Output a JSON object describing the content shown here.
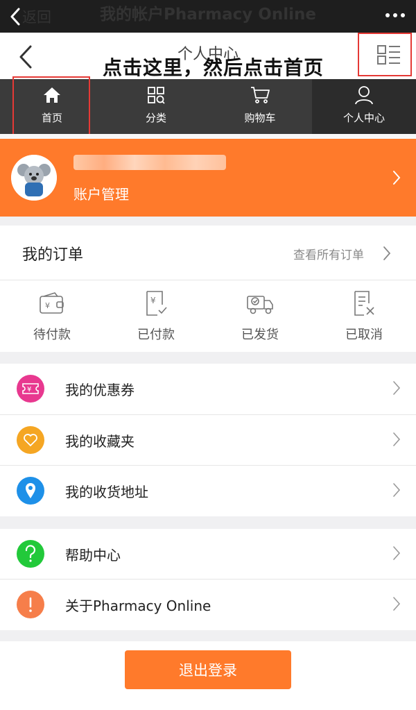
{
  "wechat_bar": {
    "back_label": "返回",
    "title": "我的帐户Pharmacy Online"
  },
  "header": {
    "title": "个人中心",
    "annotation": "点击这里，然后点击首页"
  },
  "nav": [
    {
      "label": "首页",
      "icon": "home-icon"
    },
    {
      "label": "分类",
      "icon": "category-icon"
    },
    {
      "label": "购物车",
      "icon": "cart-icon"
    },
    {
      "label": "个人中心",
      "icon": "user-icon"
    }
  ],
  "profile": {
    "account_label": "账户管理"
  },
  "orders": {
    "title": "我的订单",
    "view_all": "查看所有订单",
    "statuses": [
      {
        "label": "待付款",
        "icon": "wallet-icon"
      },
      {
        "label": "已付款",
        "icon": "paid-receipt-icon"
      },
      {
        "label": "已发货",
        "icon": "truck-icon"
      },
      {
        "label": "已取消",
        "icon": "cancelled-receipt-icon"
      }
    ]
  },
  "menu": {
    "coupons": "我的优惠券",
    "favorites": "我的收藏夹",
    "address": "我的收货地址",
    "help": "帮助中心",
    "about": "关于Pharmacy Online"
  },
  "logout_label": "退出登录",
  "colors": {
    "accent_orange": "#ff7a2b",
    "coupon_pink": "#e8388f",
    "favorites_orange": "#f5a623",
    "address_blue": "#1e90e8",
    "help_green": "#22c93a",
    "about_orange": "#f67e4a",
    "highlight_red": "#e53935"
  }
}
